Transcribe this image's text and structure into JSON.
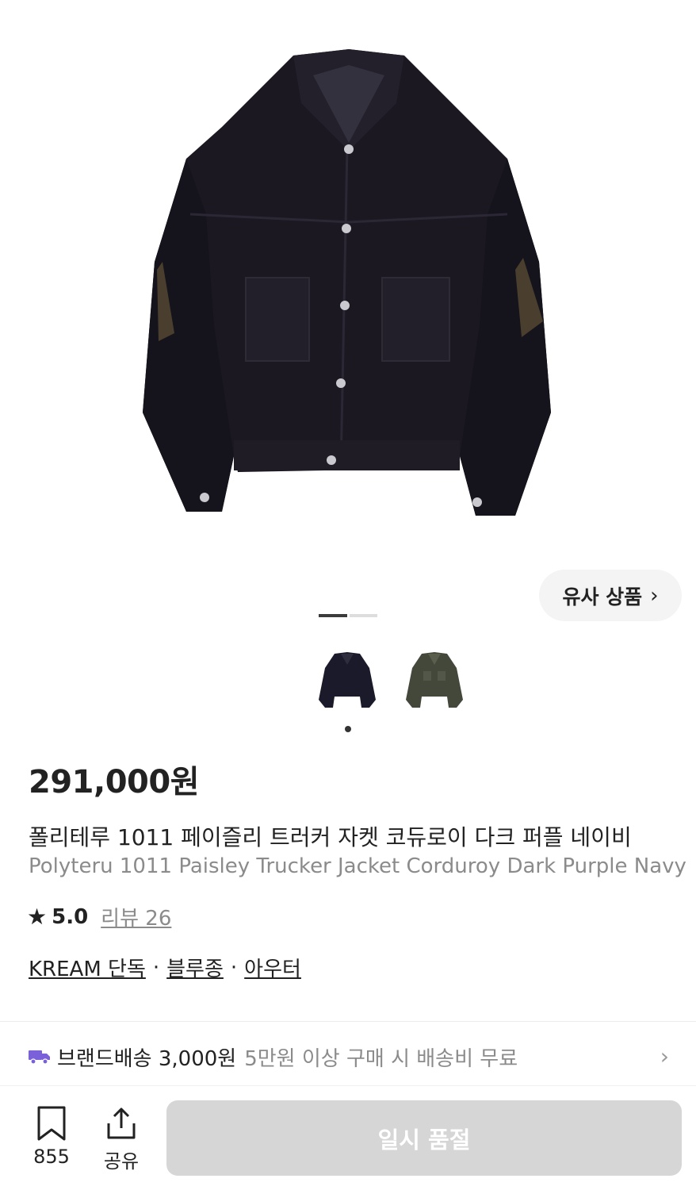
{
  "hero": {
    "image": "jacket-front-photo"
  },
  "similar_button": {
    "label": "유사 상품",
    "icon": "chevron-right-icon"
  },
  "pager": {
    "current": 1,
    "total": 2
  },
  "thumbnails": [
    {
      "name": "thumb-navy-jacket",
      "color": "#1a1a2a"
    },
    {
      "name": "thumb-olive-jacket",
      "color": "#44483a"
    }
  ],
  "price": "291,000원",
  "product": {
    "name_ko": "폴리테루 1011 페이즐리 트러커 자켓 코듀로이 다크 퍼플 네이비",
    "name_en": "Polyteru 1011 Paisley Trucker Jacket Corduroy Dark Purple Navy"
  },
  "rating": {
    "star_icon": "star-icon",
    "score": "5.0",
    "review_label": "리뷰 26"
  },
  "categories": {
    "items": [
      "KREAM 단독",
      "블루종",
      "아우터"
    ],
    "separator": "·"
  },
  "delivery": {
    "icon": "truck-icon",
    "label": "브랜드배송 3,000원",
    "sub": "5만원 이상 구매 시 배송비 무료",
    "accent": "#7b61d9"
  },
  "bottom_bar": {
    "bookmark_count": "855",
    "share_label": "공유",
    "buy_label": "일시 품절"
  }
}
